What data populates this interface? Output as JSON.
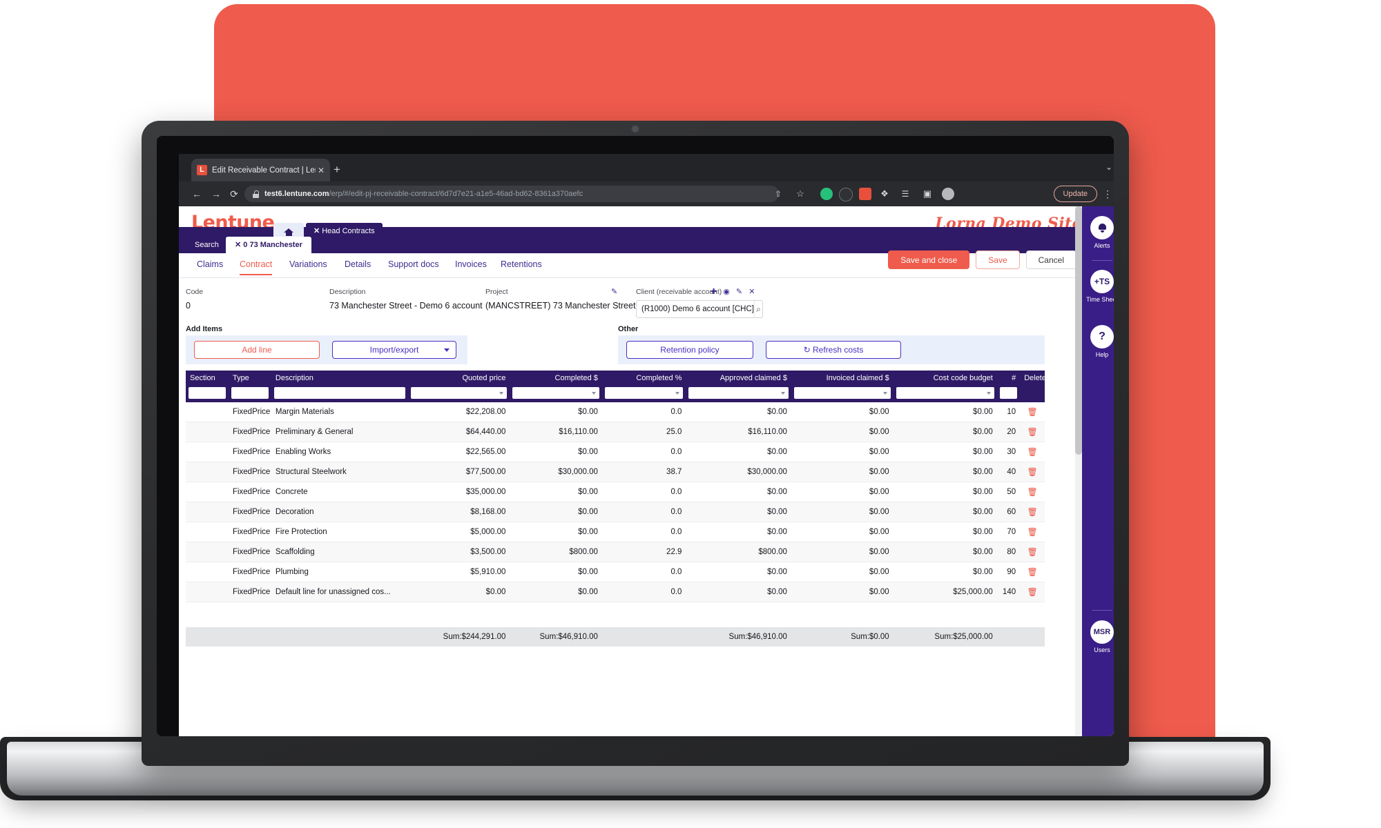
{
  "browser": {
    "tab_title": "Edit Receivable Contract | Lent",
    "tab_close": "✕",
    "new_tab": "+",
    "favicon_letter": "L",
    "back": "←",
    "forward": "→",
    "reload": "⟳",
    "url_domain": "test6.lentune.com",
    "url_path": "/erp/#/edit-pj-receivable-contract/6d7d7e21-a1e5-46ad-bd62-8361a370aefc",
    "update_label": "Update",
    "kebab": "⋮",
    "share_icon": "⇧",
    "star_icon": "☆",
    "puzzle_icon": "❖",
    "list_icon": "☰",
    "square_icon": "▣",
    "avatar_icon": "●",
    "window_chevron": "⌄"
  },
  "app": {
    "logo": "Lentune",
    "site_name": "Lorna Demo Site",
    "home_tab": "home",
    "head_contracts_tab": {
      "close": "✕",
      "label": "Head Contracts"
    },
    "tabs": [
      {
        "label": "Search",
        "active": false
      },
      {
        "label": "✕ 0 73 Manchester",
        "active": true
      }
    ],
    "subnav": [
      {
        "label": "Claims",
        "active": false
      },
      {
        "label": "Contract",
        "active": true
      },
      {
        "label": "Variations",
        "active": false
      },
      {
        "label": "Details",
        "active": false
      },
      {
        "label": "Support docs",
        "active": false
      },
      {
        "label": "Invoices",
        "active": false
      },
      {
        "label": "Retentions",
        "active": false
      }
    ],
    "actions": {
      "save_and_close": "Save and close",
      "save": "Save",
      "cancel": "Cancel"
    },
    "form": {
      "code_label": "Code",
      "code_value": "0",
      "description_label": "Description",
      "description_value": "73 Manchester Street - Demo 6 account",
      "project_label": "Project",
      "project_value": "(MANCSTREET) 73 Manchester Street",
      "project_edit_icon": "✎",
      "client_label": "Client (receivable account)",
      "client_value": "(R1000) Demo 6 account [CHC]",
      "client_icons": "✚ ◉ ✎ ✕",
      "client_search_icon": "⌕"
    },
    "panels": {
      "add_items_title": "Add Items",
      "add_line": "Add line",
      "import_export": "Import/export",
      "other_title": "Other",
      "retention_policy": "Retention policy",
      "refresh_costs": "↻ Refresh costs"
    },
    "table": {
      "columns": [
        "Section",
        "Type",
        "Description",
        "Quoted price",
        "Completed $",
        "Completed %",
        "Approved claimed $",
        "Invoiced claimed $",
        "Cost code budget",
        "#",
        "Delete"
      ],
      "rows": [
        {
          "section": "",
          "type": "FixedPrice",
          "description": "Margin Materials",
          "quoted": "$22,208.00",
          "completed_d": "$0.00",
          "completed_p": "0.0",
          "approved": "$0.00",
          "invoiced": "$0.00",
          "budget": "$0.00",
          "num": "10",
          "delete": "🗑"
        },
        {
          "section": "",
          "type": "FixedPrice",
          "description": "Preliminary & General",
          "quoted": "$64,440.00",
          "completed_d": "$16,110.00",
          "completed_p": "25.0",
          "approved": "$16,110.00",
          "invoiced": "$0.00",
          "budget": "$0.00",
          "num": "20",
          "delete": "🗑"
        },
        {
          "section": "",
          "type": "FixedPrice",
          "description": "Enabling Works",
          "quoted": "$22,565.00",
          "completed_d": "$0.00",
          "completed_p": "0.0",
          "approved": "$0.00",
          "invoiced": "$0.00",
          "budget": "$0.00",
          "num": "30",
          "delete": "🗑"
        },
        {
          "section": "",
          "type": "FixedPrice",
          "description": "Structural Steelwork",
          "quoted": "$77,500.00",
          "completed_d": "$30,000.00",
          "completed_p": "38.7",
          "approved": "$30,000.00",
          "invoiced": "$0.00",
          "budget": "$0.00",
          "num": "40",
          "delete": "🗑"
        },
        {
          "section": "",
          "type": "FixedPrice",
          "description": "Concrete",
          "quoted": "$35,000.00",
          "completed_d": "$0.00",
          "completed_p": "0.0",
          "approved": "$0.00",
          "invoiced": "$0.00",
          "budget": "$0.00",
          "num": "50",
          "delete": "🗑"
        },
        {
          "section": "",
          "type": "FixedPrice",
          "description": "Decoration",
          "quoted": "$8,168.00",
          "completed_d": "$0.00",
          "completed_p": "0.0",
          "approved": "$0.00",
          "invoiced": "$0.00",
          "budget": "$0.00",
          "num": "60",
          "delete": "🗑"
        },
        {
          "section": "",
          "type": "FixedPrice",
          "description": "Fire Protection",
          "quoted": "$5,000.00",
          "completed_d": "$0.00",
          "completed_p": "0.0",
          "approved": "$0.00",
          "invoiced": "$0.00",
          "budget": "$0.00",
          "num": "70",
          "delete": "🗑"
        },
        {
          "section": "",
          "type": "FixedPrice",
          "description": "Scaffolding",
          "quoted": "$3,500.00",
          "completed_d": "$800.00",
          "completed_p": "22.9",
          "approved": "$800.00",
          "invoiced": "$0.00",
          "budget": "$0.00",
          "num": "80",
          "delete": "🗑"
        },
        {
          "section": "",
          "type": "FixedPrice",
          "description": "Plumbing",
          "quoted": "$5,910.00",
          "completed_d": "$0.00",
          "completed_p": "0.0",
          "approved": "$0.00",
          "invoiced": "$0.00",
          "budget": "$0.00",
          "num": "90",
          "delete": "🗑"
        },
        {
          "section": "",
          "type": "FixedPrice",
          "description": "Default line for unassigned cos...",
          "quoted": "$0.00",
          "completed_d": "$0.00",
          "completed_p": "0.0",
          "approved": "$0.00",
          "invoiced": "$0.00",
          "budget": "$25,000.00",
          "num": "140",
          "delete": "🗑"
        }
      ],
      "summary": {
        "quoted": "Sum:$244,291.00",
        "completed_d": "Sum:$46,910.00",
        "completed_p": "",
        "approved": "Sum:$46,910.00",
        "invoiced": "Sum:$0.00",
        "budget": "Sum:$25,000.00"
      }
    },
    "rail": [
      {
        "icon": "bell",
        "label": "Alerts"
      },
      {
        "icon": "+TS",
        "label": "Time Sheet"
      },
      {
        "icon": "?",
        "label": "Help"
      },
      {
        "icon": "MSR",
        "label": "Users"
      }
    ]
  },
  "colors": {
    "brand_coral": "#ef5b4c",
    "brand_purple": "#2e1a66",
    "rail_purple": "#3a1e87",
    "link_purple": "#4b2ec4"
  }
}
